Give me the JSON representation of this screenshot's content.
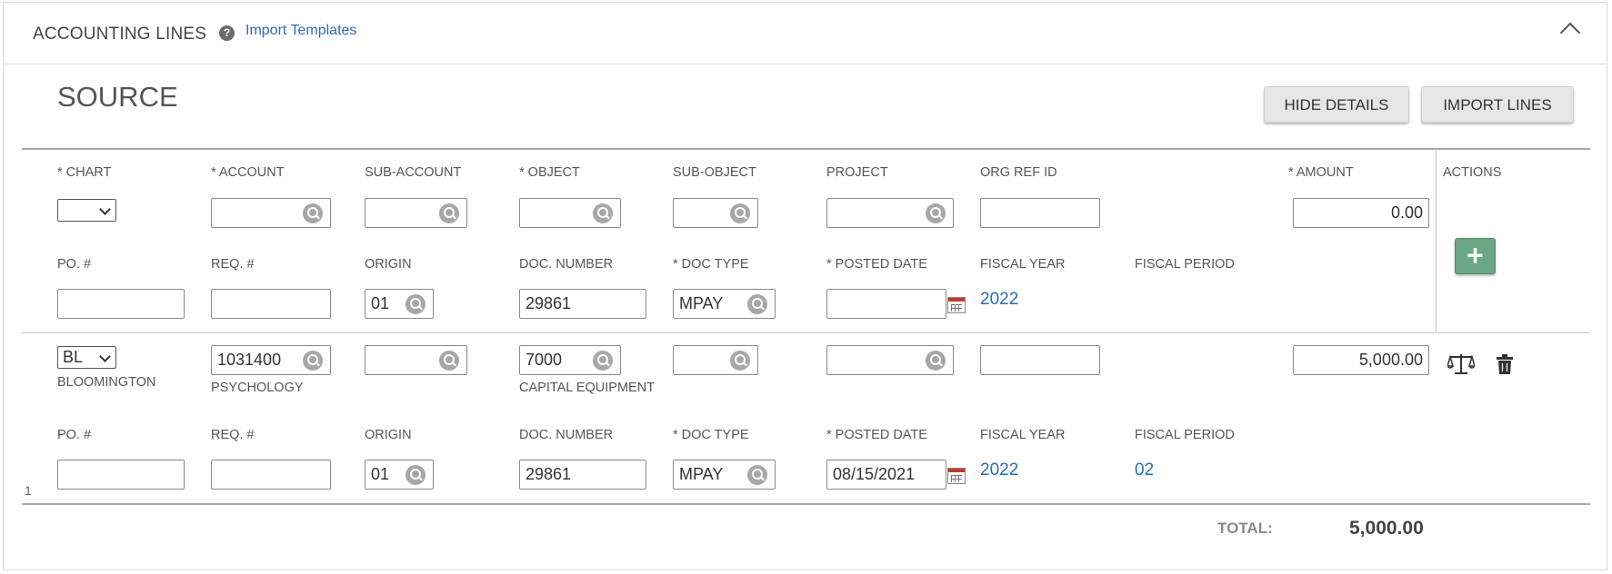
{
  "header": {
    "title": "ACCOUNTING LINES",
    "help_glyph": "?",
    "import_templates": "Import Templates"
  },
  "source": {
    "title": "SOURCE",
    "hide_details": "HIDE DETAILS",
    "import_lines": "IMPORT LINES"
  },
  "columns": {
    "chart": "* CHART",
    "account": "* ACCOUNT",
    "sub_account": "SUB-ACCOUNT",
    "object": "* OBJECT",
    "sub_object": "SUB-OBJECT",
    "project": "PROJECT",
    "org_ref_id": "ORG REF ID",
    "amount": "* AMOUNT",
    "actions": "ACTIONS"
  },
  "detail_columns": {
    "po": "PO. #",
    "req": "REQ. #",
    "origin": "ORIGIN",
    "doc_number": "DOC. NUMBER",
    "doc_type": "* DOC TYPE",
    "posted_date": "* POSTED DATE",
    "fiscal_year": "FISCAL YEAR",
    "fiscal_period": "FISCAL PERIOD"
  },
  "new_line": {
    "chart": "",
    "account": "",
    "sub_account": "",
    "object": "",
    "sub_object": "",
    "project": "",
    "org_ref_id": "",
    "amount": "0.00",
    "po": "",
    "req": "",
    "origin": "01",
    "doc_number": "29861",
    "doc_type": "MPAY",
    "posted_date": "",
    "fiscal_year": "2022",
    "fiscal_period": "",
    "add_glyph": "+"
  },
  "line_1": {
    "number": "1",
    "chart": "BL",
    "chart_name": "BLOOMINGTON",
    "account": "1031400",
    "account_name": "PSYCHOLOGY",
    "sub_account": "",
    "object": "7000",
    "object_name": "CAPITAL EQUIPMENT",
    "sub_object": "",
    "project": "",
    "org_ref_id": "",
    "amount": "5,000.00",
    "po": "",
    "req": "",
    "origin": "01",
    "doc_number": "29861",
    "doc_type": "MPAY",
    "posted_date": "08/15/2021",
    "fiscal_year": "2022",
    "fiscal_period": "02"
  },
  "totals": {
    "label": "TOTAL:",
    "value": "5,000.00"
  },
  "icons": {
    "help": "help-icon",
    "collapse": "chevron-up-icon",
    "search": "search-icon",
    "calendar": "calendar-icon",
    "balance": "balance-icon",
    "delete": "trash-icon"
  }
}
